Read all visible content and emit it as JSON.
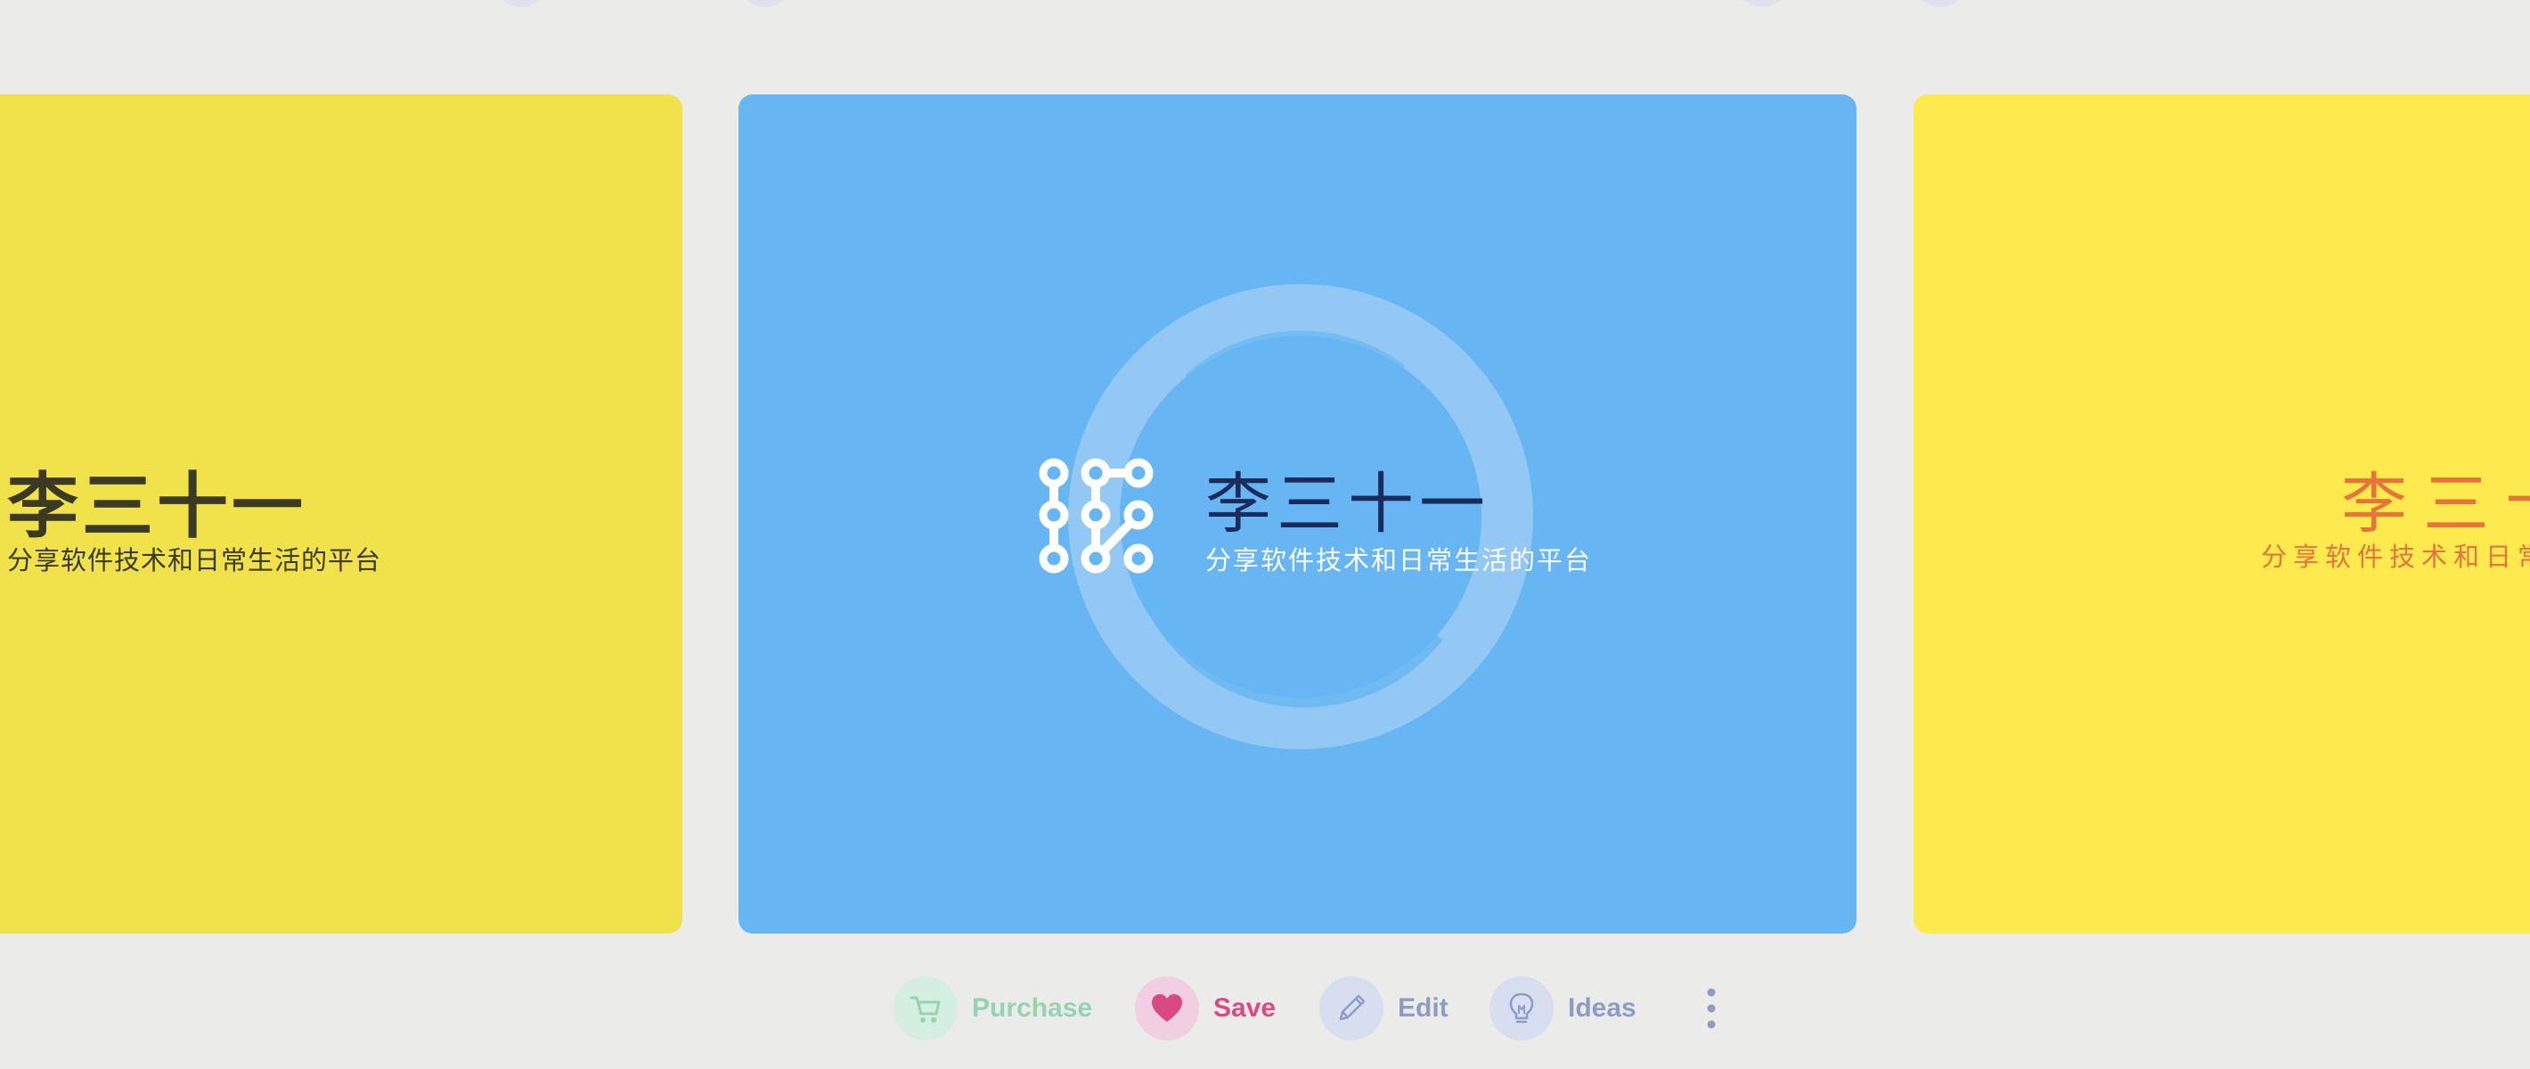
{
  "cards": {
    "left": {
      "title": "李三十一",
      "subtitle": "分享软件技术和日常生活的平台",
      "background": "#f1e24b"
    },
    "center": {
      "title": "李三十一",
      "subtitle": "分享软件技术和日常生活的平台",
      "background": "#67b6f3",
      "title_color": "#1a2b5c"
    },
    "right": {
      "title": "李三十",
      "subtitle": "分享软件技术和日常",
      "background": "#fcea4f",
      "text_color": "#e8743c"
    }
  },
  "actions": {
    "purchase": {
      "label": "Purchase",
      "icon": "cart-icon"
    },
    "save": {
      "label": "Save",
      "icon": "heart-icon"
    },
    "edit": {
      "label": "Edit",
      "icon": "pencil-icon"
    },
    "ideas": {
      "label": "Ideas",
      "icon": "lightbulb-icon"
    },
    "more": {
      "icon": "more-vertical-icon"
    }
  }
}
